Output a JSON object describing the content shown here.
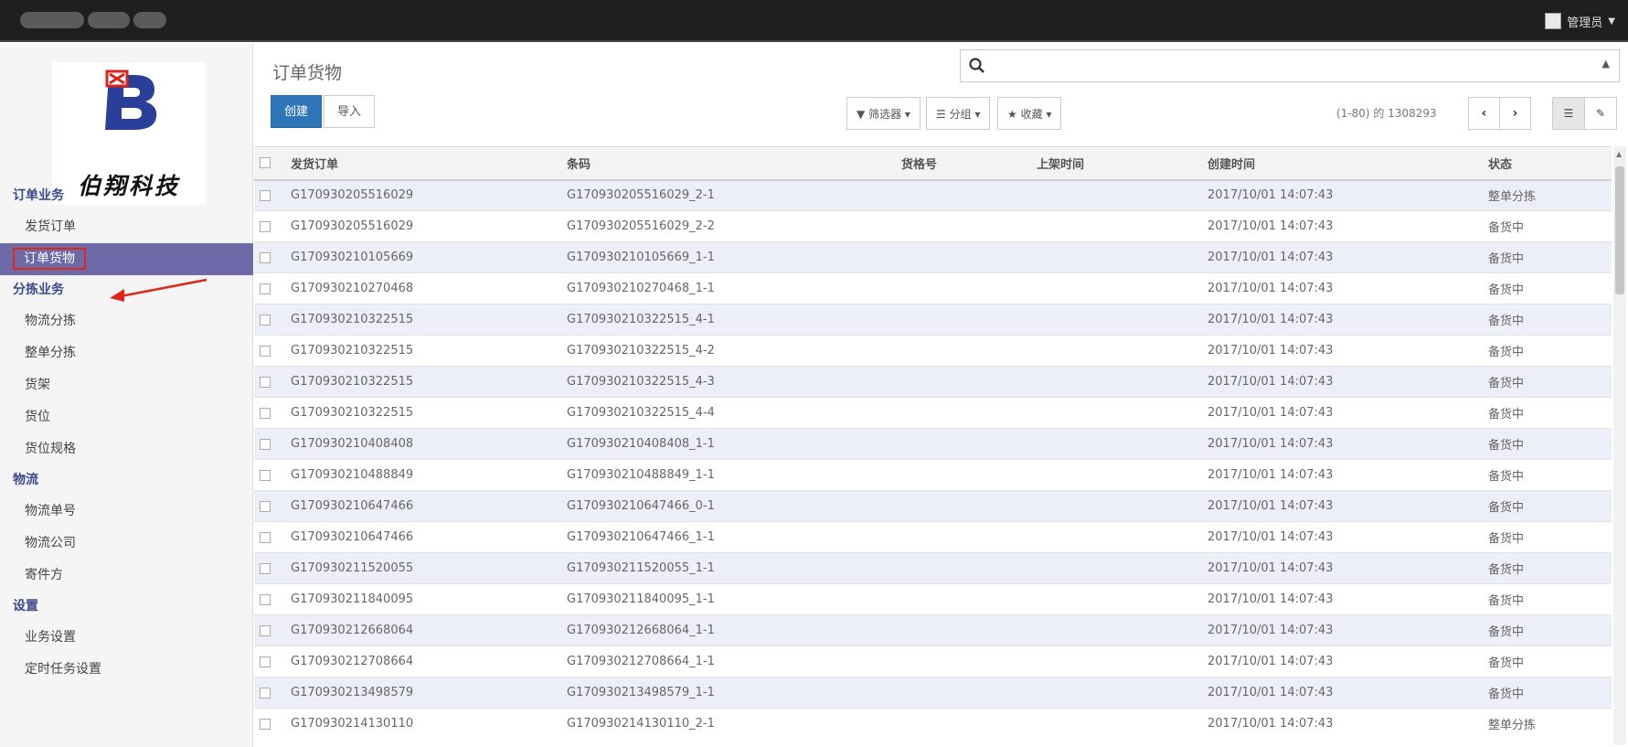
{
  "header": {
    "user_name": "管理员"
  },
  "sidebar": {
    "logo_text": "伯翔科技",
    "sections": [
      {
        "title": "订单业务",
        "items": [
          "发货订单",
          "订单货物"
        ]
      },
      {
        "title": "分拣业务",
        "items": [
          "物流分拣",
          "整单分拣",
          "货架",
          "货位",
          "货位规格"
        ]
      },
      {
        "title": "物流",
        "items": [
          "物流单号",
          "物流公司",
          "寄件方"
        ]
      },
      {
        "title": "设置",
        "items": [
          "业务设置",
          "定时任务设置"
        ]
      }
    ],
    "active_item": "订单货物"
  },
  "main": {
    "title": "订单货物",
    "create_label": "创建",
    "import_label": "导入",
    "search": {
      "placeholder": "",
      "value": ""
    },
    "filters_label": "筛选器",
    "group_label": "分组",
    "favorites_label": "收藏",
    "pager_text": "(1-80) 的 1308293",
    "table": {
      "columns": [
        "发货订单",
        "条码",
        "货格号",
        "上架时间",
        "创建时间",
        "状态"
      ],
      "rows": [
        [
          "G170930205516029",
          "G170930205516029_2-1",
          "",
          "",
          "2017/10/01 14:07:43",
          "整单分拣"
        ],
        [
          "G170930205516029",
          "G170930205516029_2-2",
          "",
          "",
          "2017/10/01 14:07:43",
          "备货中"
        ],
        [
          "G170930210105669",
          "G170930210105669_1-1",
          "",
          "",
          "2017/10/01 14:07:43",
          "备货中"
        ],
        [
          "G170930210270468",
          "G170930210270468_1-1",
          "",
          "",
          "2017/10/01 14:07:43",
          "备货中"
        ],
        [
          "G170930210322515",
          "G170930210322515_4-1",
          "",
          "",
          "2017/10/01 14:07:43",
          "备货中"
        ],
        [
          "G170930210322515",
          "G170930210322515_4-2",
          "",
          "",
          "2017/10/01 14:07:43",
          "备货中"
        ],
        [
          "G170930210322515",
          "G170930210322515_4-3",
          "",
          "",
          "2017/10/01 14:07:43",
          "备货中"
        ],
        [
          "G170930210322515",
          "G170930210322515_4-4",
          "",
          "",
          "2017/10/01 14:07:43",
          "备货中"
        ],
        [
          "G170930210408408",
          "G170930210408408_1-1",
          "",
          "",
          "2017/10/01 14:07:43",
          "备货中"
        ],
        [
          "G170930210488849",
          "G170930210488849_1-1",
          "",
          "",
          "2017/10/01 14:07:43",
          "备货中"
        ],
        [
          "G170930210647466",
          "G170930210647466_0-1",
          "",
          "",
          "2017/10/01 14:07:43",
          "备货中"
        ],
        [
          "G170930210647466",
          "G170930210647466_1-1",
          "",
          "",
          "2017/10/01 14:07:43",
          "备货中"
        ],
        [
          "G170930211520055",
          "G170930211520055_1-1",
          "",
          "",
          "2017/10/01 14:07:43",
          "备货中"
        ],
        [
          "G170930211840095",
          "G170930211840095_1-1",
          "",
          "",
          "2017/10/01 14:07:43",
          "备货中"
        ],
        [
          "G170930212668064",
          "G170930212668064_1-1",
          "",
          "",
          "2017/10/01 14:07:43",
          "备货中"
        ],
        [
          "G170930212708664",
          "G170930212708664_1-1",
          "",
          "",
          "2017/10/01 14:07:43",
          "备货中"
        ],
        [
          "G170930213498579",
          "G170930213498579_1-1",
          "",
          "",
          "2017/10/01 14:07:43",
          "备货中"
        ],
        [
          "G170930214130110",
          "G170930214130110_2-1",
          "",
          "",
          "2017/10/01 14:07:43",
          "整单分拣"
        ]
      ]
    }
  },
  "colors": {
    "primary": "#2f76b9",
    "active_nav": "#6e6aa8",
    "highlight": "#e0251b",
    "logo_blue": "#2a3f9a"
  }
}
